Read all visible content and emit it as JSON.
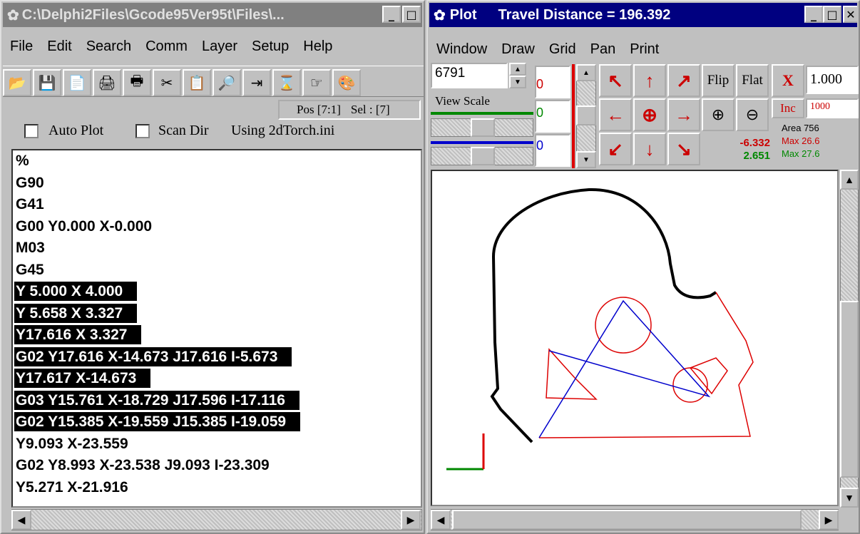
{
  "left_window": {
    "title": "C:\\Delphi2Files\\Gcode95Ver95t\\Files\\...",
    "menu": [
      "File",
      "Edit",
      "Search",
      "Comm",
      "Layer",
      "Setup",
      "Help"
    ],
    "status_pos": "Pos [7:1]",
    "status_sel": "Sel : [7]",
    "auto_plot_label": "Auto Plot",
    "scan_dir_label": "Scan Dir",
    "using_label": "Using 2dTorch.ini",
    "code_lines": [
      {
        "text": "%",
        "selected": false
      },
      {
        "text": "G90",
        "selected": false
      },
      {
        "text": "G41",
        "selected": false
      },
      {
        "text": "G00 Y0.000 X-0.000",
        "selected": false
      },
      {
        "text": "M03",
        "selected": false
      },
      {
        "text": "G45",
        "selected": false
      },
      {
        "text": "Y 5.000 X 4.000",
        "selected": true
      },
      {
        "text": "Y 5.658 X 3.327",
        "selected": true
      },
      {
        "text": "Y17.616 X 3.327",
        "selected": true
      },
      {
        "text": "G02 Y17.616 X-14.673 J17.616 I-5.673",
        "selected": true
      },
      {
        "text": "Y17.617 X-14.673",
        "selected": true
      },
      {
        "text": "G03 Y15.761 X-18.729 J17.596 I-17.116",
        "selected": true
      },
      {
        "text": "G02 Y15.385 X-19.559 J15.385 I-19.059",
        "selected": true
      },
      {
        "text": "Y9.093 X-23.559",
        "selected": false
      },
      {
        "text": "G02 Y8.993 X-23.538 J9.093 I-23.309",
        "selected": false
      },
      {
        "text": "Y5.271 X-21.916",
        "selected": false
      }
    ]
  },
  "plot_window": {
    "title_app": "Plot",
    "title_info": "Travel Distance = 196.392",
    "menu": [
      "Window",
      "Draw",
      "Grid",
      "Pan",
      "Print"
    ],
    "spin_value": "6791",
    "view_scale_label": "View Scale",
    "field_values": [
      "0",
      "0",
      "0"
    ],
    "flip_label": "Flip",
    "flat_label": "Flat",
    "x_label": "X",
    "x_value": "1.000",
    "inc_label": "Inc",
    "inc_value": "1000",
    "readout_x": "-6.332",
    "readout_y": "2.651",
    "area": "Area 756",
    "max1": "Max 26.6",
    "max2": "Max 27.6"
  },
  "icons": {
    "toolbar": [
      "open-folder-icon",
      "save-disk-icon",
      "copy-doc-icon",
      "print-icon",
      "print-setup-icon",
      "scissors-icon",
      "paste-icon",
      "find-doc-icon",
      "indent-icon",
      "hourglass-icon",
      "pointer-hand-icon",
      "palette-icon"
    ],
    "move": [
      "arrow-nw-icon",
      "arrow-up-icon",
      "arrow-ne-icon",
      "arrow-left-icon",
      "center-target-icon",
      "arrow-right-icon",
      "arrow-sw-icon",
      "arrow-down-icon",
      "arrow-se-icon"
    ]
  },
  "colors": {
    "title_active": "#000080",
    "title_inactive": "#808080",
    "path_black": "#000000",
    "path_red": "#dd0000",
    "path_blue": "#0000cc",
    "readout_red": "#cc0000",
    "readout_green": "#008800"
  }
}
